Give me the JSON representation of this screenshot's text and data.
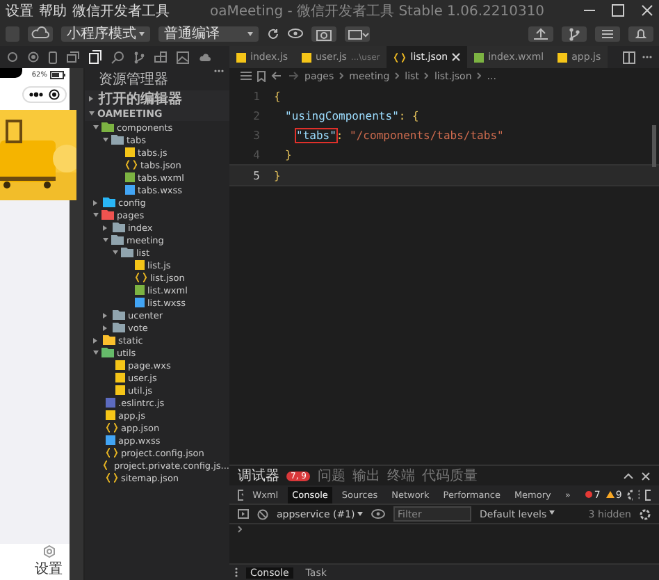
{
  "menu": [
    "设置",
    "帮助",
    "微信开发者工具"
  ],
  "window": {
    "title": "oaMeeting - 微信开发者工具 Stable 1.06.2210310"
  },
  "toolbar": {
    "mode": "小程序模式",
    "compile": "普通编译"
  },
  "phone": {
    "battery": "62%",
    "tab_label": "设置"
  },
  "explorer": {
    "title": "资源管理器",
    "open_editors": "打开的编辑器",
    "project": "OAMEETING",
    "tree": [
      {
        "name": "components",
        "kind": "folder",
        "color": "#7cb342",
        "expanded": true,
        "children": [
          {
            "name": "tabs",
            "kind": "folder",
            "color": "#90a4ae",
            "expanded": true,
            "children": [
              {
                "name": "tabs.js",
                "kind": "js"
              },
              {
                "name": "tabs.json",
                "kind": "json"
              },
              {
                "name": "tabs.wxml",
                "kind": "wxml"
              },
              {
                "name": "tabs.wxss",
                "kind": "wxss"
              }
            ]
          }
        ]
      },
      {
        "name": "config",
        "kind": "folder",
        "color": "#29b6f6",
        "expanded": false
      },
      {
        "name": "pages",
        "kind": "folder",
        "color": "#ef5350",
        "expanded": true,
        "children": [
          {
            "name": "index",
            "kind": "folder",
            "color": "#90a4ae",
            "expanded": false
          },
          {
            "name": "meeting",
            "kind": "folder",
            "color": "#90a4ae",
            "expanded": true,
            "children": [
              {
                "name": "list",
                "kind": "folder",
                "color": "#90a4ae",
                "expanded": true,
                "children": [
                  {
                    "name": "list.js",
                    "kind": "js"
                  },
                  {
                    "name": "list.json",
                    "kind": "json"
                  },
                  {
                    "name": "list.wxml",
                    "kind": "wxml"
                  },
                  {
                    "name": "list.wxss",
                    "kind": "wxss"
                  }
                ]
              }
            ]
          },
          {
            "name": "ucenter",
            "kind": "folder",
            "color": "#90a4ae",
            "expanded": false
          },
          {
            "name": "vote",
            "kind": "folder",
            "color": "#90a4ae",
            "expanded": false
          }
        ]
      },
      {
        "name": "static",
        "kind": "folder",
        "color": "#fbc02d",
        "expanded": false
      },
      {
        "name": "utils",
        "kind": "folder",
        "color": "#66bb6a",
        "expanded": true,
        "children": [
          {
            "name": "page.wxs",
            "kind": "js"
          },
          {
            "name": "user.js",
            "kind": "js"
          },
          {
            "name": "util.js",
            "kind": "js"
          }
        ]
      },
      {
        "name": ".eslintrc.js",
        "kind": "eslint"
      },
      {
        "name": "app.js",
        "kind": "js"
      },
      {
        "name": "app.json",
        "kind": "json"
      },
      {
        "name": "app.wxss",
        "kind": "wxss"
      },
      {
        "name": "project.config.json",
        "kind": "json"
      },
      {
        "name": "project.private.config.js...",
        "kind": "json"
      },
      {
        "name": "sitemap.json",
        "kind": "json"
      }
    ]
  },
  "editor_tabs": [
    {
      "label": "index.js",
      "kind": "js",
      "selected": false
    },
    {
      "label": "user.js",
      "detail": "...\\user",
      "kind": "js",
      "selected": false
    },
    {
      "label": "list.json",
      "kind": "json",
      "selected": true
    },
    {
      "label": "index.wxml",
      "kind": "wxml",
      "selected": false
    },
    {
      "label": "app.js",
      "kind": "js",
      "selected": false
    }
  ],
  "breadcrumb": [
    "pages",
    "meeting",
    "list",
    "list.json",
    "..."
  ],
  "code": [
    {
      "number": "1",
      "current": false,
      "tokens": [
        {
          "kind": "punct",
          "text": "{"
        }
      ]
    },
    {
      "number": "2",
      "current": false,
      "tokens": [
        {
          "kind": "key",
          "text": "\"usingComponents\""
        },
        {
          "kind": "punct",
          "text": ": {"
        }
      ]
    },
    {
      "number": "3",
      "current": false,
      "tokens": [
        {
          "kind": "key",
          "text": "\"tabs\"",
          "boxed": true
        },
        {
          "kind": "punct",
          "text": ": "
        },
        {
          "kind": "string",
          "text": "\"/components/tabs/tabs\""
        }
      ]
    },
    {
      "number": "4",
      "current": false,
      "tokens": [
        {
          "kind": "punct",
          "text": "}"
        }
      ]
    },
    {
      "number": "5",
      "current": true,
      "tokens": [
        {
          "kind": "punct",
          "text": "}"
        }
      ]
    }
  ],
  "debug": {
    "panel_tabs": [
      {
        "label": "调试器",
        "badge": "7, 9",
        "selected": true
      },
      {
        "label": "问题",
        "selected": false
      },
      {
        "label": "输出",
        "selected": false
      },
      {
        "label": "终端",
        "selected": false
      },
      {
        "label": "代码质量",
        "selected": false
      }
    ],
    "devtools_tabs": [
      {
        "label": "Wxml",
        "selected": false
      },
      {
        "label": "Console",
        "selected": true
      },
      {
        "label": "Sources",
        "selected": false
      },
      {
        "label": "Network",
        "selected": false
      },
      {
        "label": "Performance",
        "selected": false
      },
      {
        "label": "Memory",
        "selected": false
      },
      {
        "label": "»",
        "selected": false
      }
    ],
    "errors": "7",
    "warnings": "9",
    "context": "appservice (#1)",
    "filter_placeholder": "Filter",
    "levels": "Default levels",
    "hidden": "3 hidden",
    "drawer_tabs": [
      {
        "label": "Console",
        "selected": true
      },
      {
        "label": "Task",
        "selected": false
      }
    ]
  }
}
